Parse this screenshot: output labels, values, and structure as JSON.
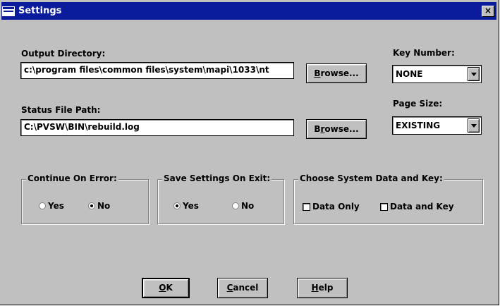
{
  "window": {
    "title": "Settings",
    "close_label": "×"
  },
  "output_directory": {
    "label": "Output Directory:",
    "value": "c:\\program files\\common files\\system\\mapi\\1033\\nt",
    "browse_pre": "",
    "browse_ul": "B",
    "browse_post": "rowse..."
  },
  "status_file": {
    "label": "Status File Path:",
    "value": "C:\\PVSW\\BIN\\rebuild.log",
    "browse_pre": "B",
    "browse_ul": "r",
    "browse_post": "owse..."
  },
  "key_number": {
    "label": "Key Number:",
    "value": "NONE"
  },
  "page_size": {
    "label": "Page Size:",
    "value": "EXISTING"
  },
  "continue_on_error": {
    "title": "Continue On Error:",
    "yes": "Yes",
    "no": "No",
    "selected": "No"
  },
  "save_settings": {
    "title": "Save Settings On Exit:",
    "yes": "Yes",
    "no": "No",
    "selected": "Yes"
  },
  "choose_system": {
    "title": "Choose System Data and Key:",
    "data_only": "Data Only",
    "data_and_key": "Data and Key"
  },
  "buttons": {
    "ok_ul": "O",
    "ok_post": "K",
    "cancel_ul": "C",
    "cancel_post": "ancel",
    "help_ul": "H",
    "help_post": "elp"
  }
}
